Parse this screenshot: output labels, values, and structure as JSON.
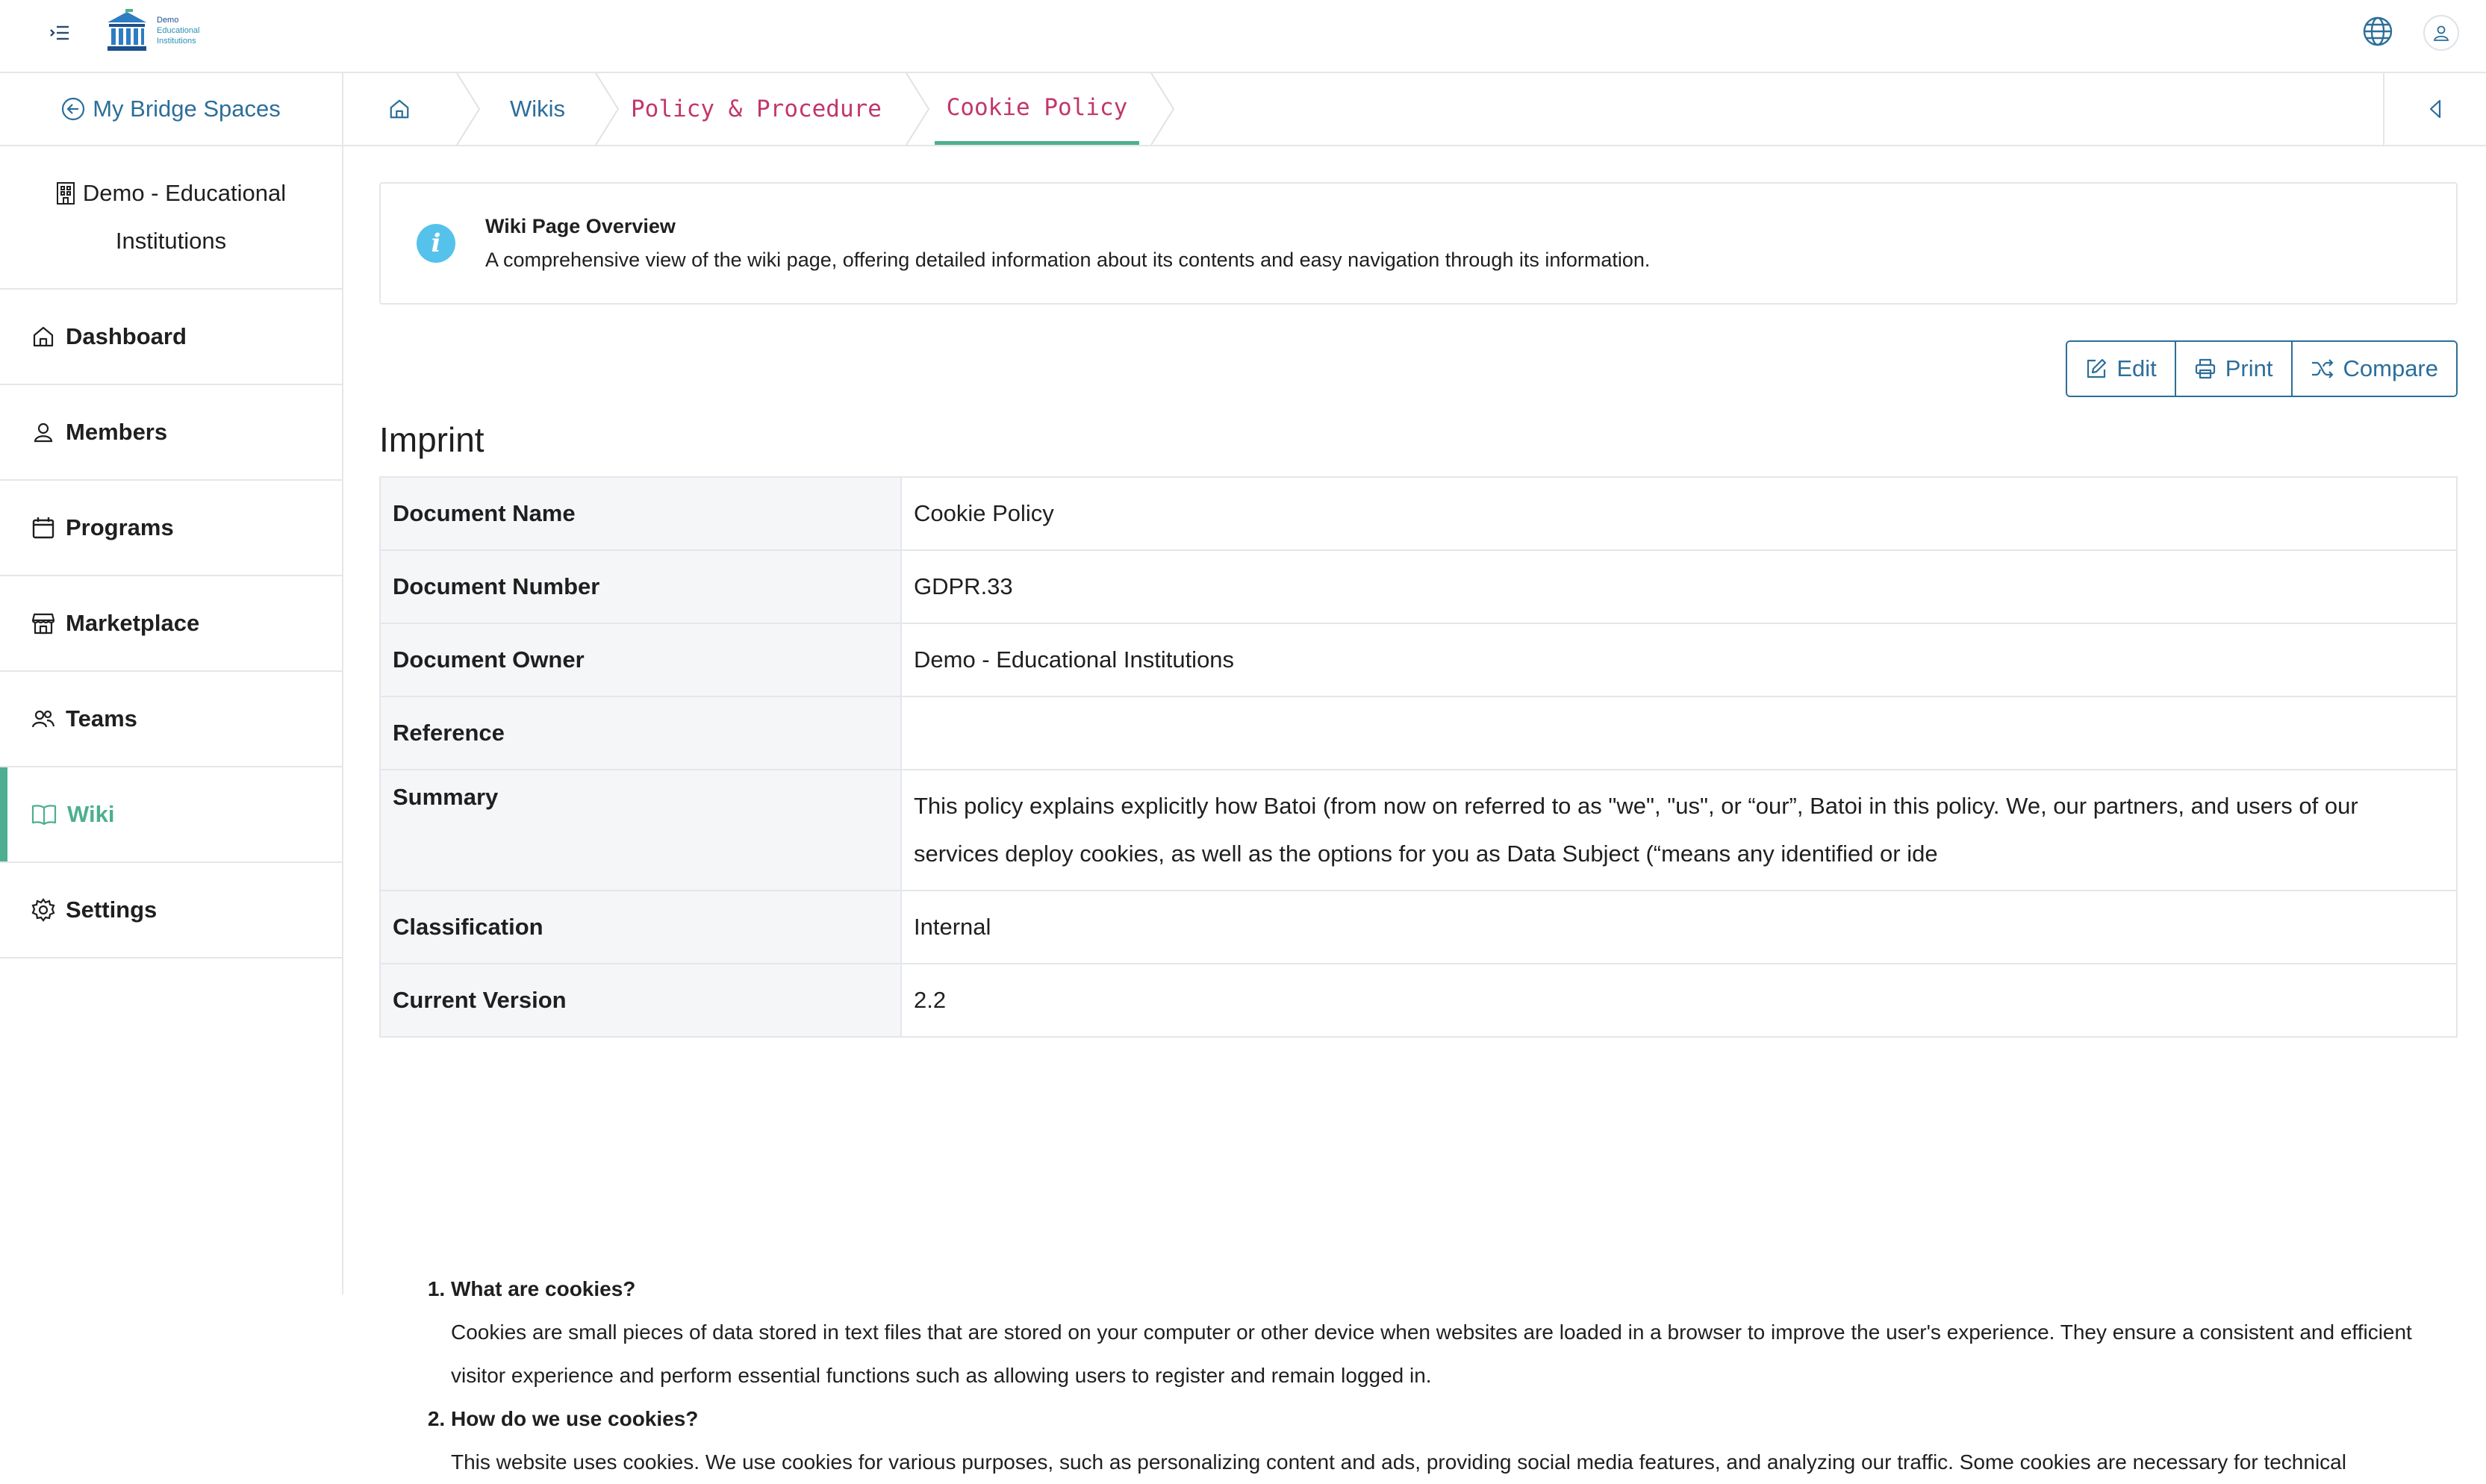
{
  "header": {
    "logo_lines": [
      "Demo",
      "Educational",
      "Institutions"
    ]
  },
  "sidebar": {
    "back_label": "My Bridge Spaces",
    "org_line1": "Demo - Educational",
    "org_line2": "Institutions",
    "items": [
      {
        "label": "Dashboard",
        "icon": "home-icon"
      },
      {
        "label": "Members",
        "icon": "user-icon"
      },
      {
        "label": "Programs",
        "icon": "calendar-icon"
      },
      {
        "label": "Marketplace",
        "icon": "store-icon"
      },
      {
        "label": "Teams",
        "icon": "users-icon"
      },
      {
        "label": "Wiki",
        "icon": "book-icon",
        "active": true
      },
      {
        "label": "Settings",
        "icon": "gear-icon"
      }
    ]
  },
  "breadcrumb": {
    "items": [
      "Wikis",
      "Policy & Procedure",
      "Cookie Policy"
    ]
  },
  "info": {
    "title": "Wiki Page Overview",
    "description": "A comprehensive view of the wiki page, offering detailed information about its contents and easy navigation through its information."
  },
  "actions": {
    "edit": "Edit",
    "print": "Print",
    "compare": "Compare"
  },
  "imprint": {
    "title": "Imprint",
    "rows": [
      {
        "label": "Document Name",
        "value": "Cookie Policy"
      },
      {
        "label": "Document Number",
        "value": "GDPR.33"
      },
      {
        "label": "Document Owner",
        "value": "Demo - Educational Institutions"
      },
      {
        "label": "Reference",
        "value": ""
      },
      {
        "label": "Summary",
        "value": "This policy explains explicitly how Batoi (from now on referred to as \"we\", \"us\", or “our”, Batoi in this policy. We, our partners, and users of our services deploy cookies, as well as the options for you as Data Subject (“means any identified or ide"
      },
      {
        "label": "Classification",
        "value": "Internal"
      },
      {
        "label": "Current Version",
        "value": "2.2"
      }
    ]
  },
  "body": {
    "sections": [
      {
        "heading": "What are cookies?",
        "text": "Cookies are small pieces of data stored in text files that are stored on your computer or other device when websites are loaded in a browser to improve the user's experience. They ensure a consistent and efficient visitor experience and perform essential functions such as allowing users to register and remain logged in."
      },
      {
        "heading": "How do we use cookies?",
        "text": "This website uses cookies. We use cookies for various purposes, such as personalizing content and ads, providing social media features, and analyzing our traffic. Some cookies are necessary for technical"
      }
    ]
  },
  "colors": {
    "accent": "#4daf8f",
    "link": "#2c6e9a",
    "crumb_pink": "#c2366b",
    "info": "#55c2ec"
  }
}
